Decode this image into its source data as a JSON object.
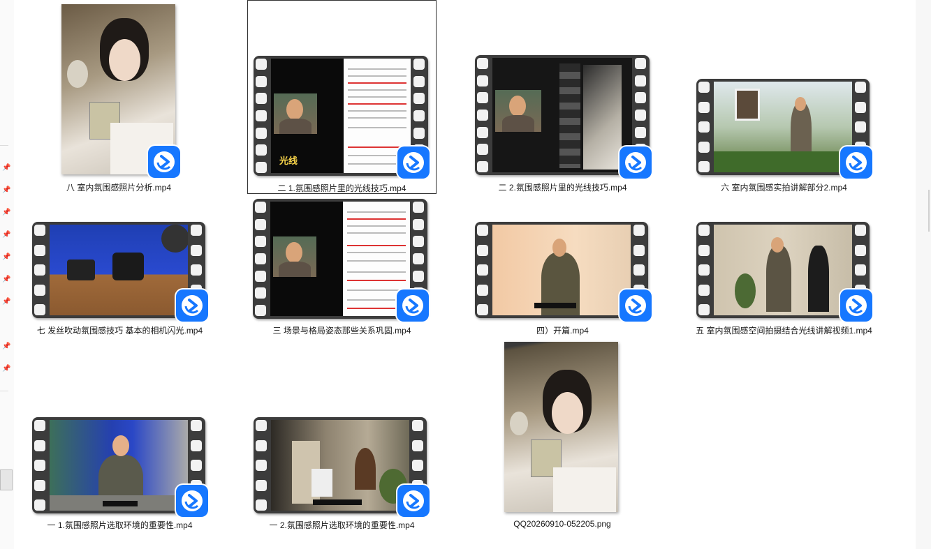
{
  "files": [
    {
      "name": "八 室内氛围感照片分析.mp4",
      "type": "video"
    },
    {
      "name": "二 1.氛围感照片里的光线技巧.mp4",
      "type": "video",
      "selected": true,
      "overlay_text": "光线"
    },
    {
      "name": "二 2.氛围感照片里的光线技巧.mp4",
      "type": "video"
    },
    {
      "name": "六 室内氛围感实拍讲解部分2.mp4",
      "type": "video"
    },
    {
      "name": "七 发丝吹动氛围感技巧 基本的相机闪光.mp4",
      "type": "video"
    },
    {
      "name": "三 场景与格局姿态那些关系巩固.mp4",
      "type": "video"
    },
    {
      "name": "四）开篇.mp4",
      "type": "video"
    },
    {
      "name": "五 室内氛围感空间拍摄结合光线讲解视频1.mp4",
      "type": "video"
    },
    {
      "name": "一 1.氛围感照片选取环境的重要性.mp4",
      "type": "video"
    },
    {
      "name": "一 2.氛围感照片选取环境的重要性.mp4",
      "type": "video"
    },
    {
      "name": "QQ20260910-052205.png",
      "type": "image"
    }
  ],
  "colors": {
    "badge": "#1677ff",
    "film": "#3c3c3c",
    "selection_border": "#333333"
  },
  "icons": {
    "badge": "video-player-icon",
    "pin": "pin-icon"
  }
}
